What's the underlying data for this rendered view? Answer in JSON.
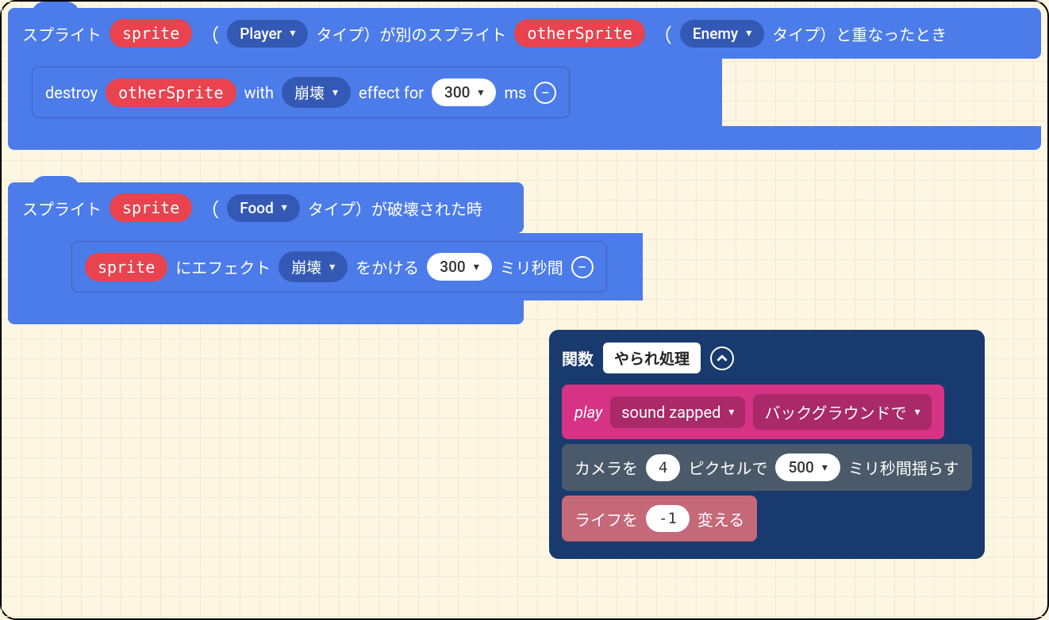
{
  "block1": {
    "hat": {
      "t1": "スプライト",
      "sprite": "sprite",
      "lp": "（",
      "kind1": "Player",
      "t2": "タイプ）が別のスプライト",
      "other": "otherSprite",
      "lp2": "（",
      "kind2": "Enemy",
      "t3": "タイプ）と重なったとき"
    },
    "inner": {
      "t1": "destroy",
      "var": "otherSprite",
      "t2": "with",
      "effect": "崩壊",
      "t3": "effect for",
      "dur": "300",
      "t4": "ms"
    }
  },
  "block2": {
    "hat": {
      "t1": "スプライト",
      "sprite": "sprite",
      "lp": "（",
      "kind": "Food",
      "t2": "タイプ）が破壊された時"
    },
    "inner": {
      "var": "sprite",
      "t1": "にエフェクト",
      "effect": "崩壊",
      "t2": "をかける",
      "dur": "300",
      "t3": "ミリ秒間"
    }
  },
  "func": {
    "label": "関数",
    "name": "やられ処理",
    "play": {
      "t1": "play",
      "sound": "sound zapped",
      "mode": "バックグラウンドで"
    },
    "shake": {
      "t1": "カメラを",
      "px": "4",
      "t2": "ピクセルで",
      "ms": "500",
      "t3": "ミリ秒間揺らす"
    },
    "life": {
      "t1": "ライフを",
      "by": "-1",
      "t2": "変える"
    }
  }
}
